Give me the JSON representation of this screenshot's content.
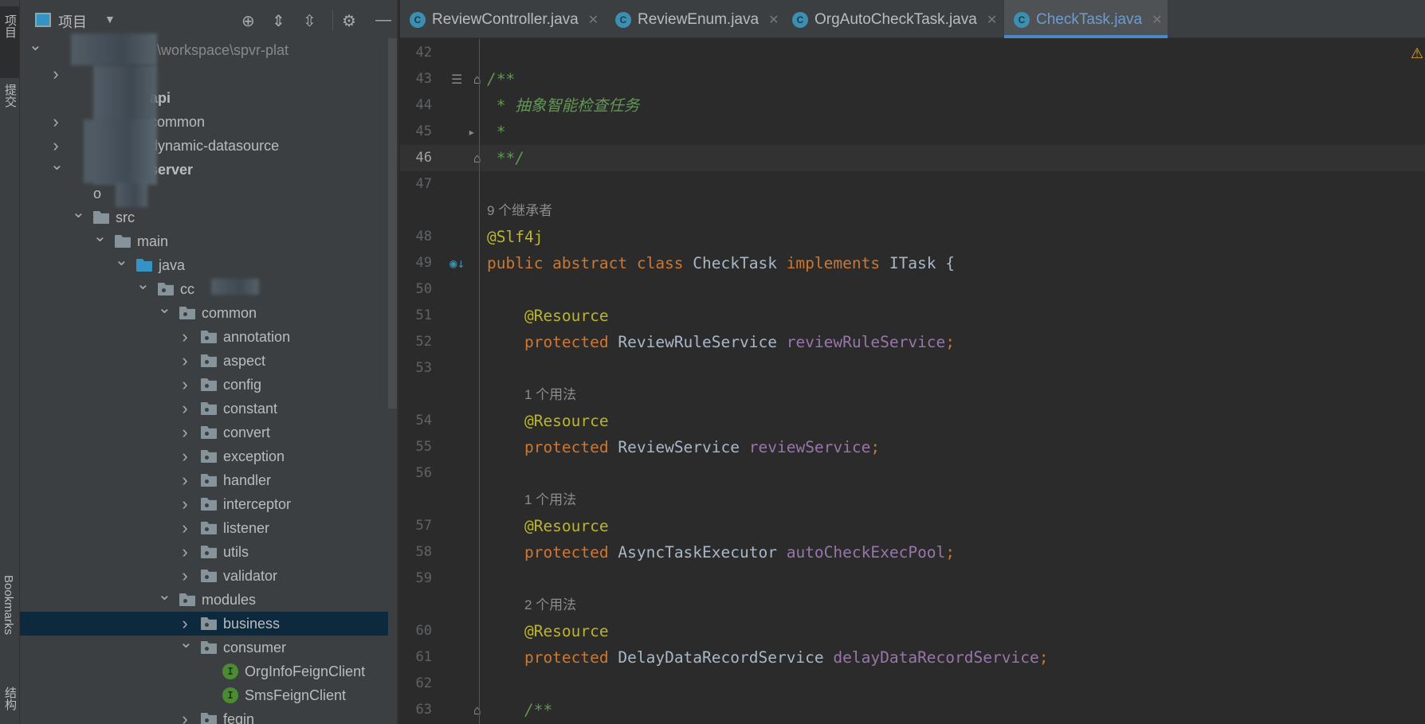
{
  "left_strip": {
    "project": "项目",
    "commit": "提交",
    "bookmarks": "Bookmarks",
    "structure": "结构"
  },
  "panel": {
    "title": "项目",
    "icons": [
      "locate-icon",
      "expand-all-icon",
      "collapse-all-icon",
      "gear-icon",
      "minimize-icon"
    ]
  },
  "tree": [
    {
      "level": 0,
      "label": "\\workspace\\spvr-plat",
      "state": "open",
      "icon": "none",
      "path": true,
      "blur": true
    },
    {
      "level": 1,
      "label": "",
      "state": "closed",
      "icon": "none",
      "blur": true
    },
    {
      "level": 1,
      "label": "api",
      "state": "none",
      "icon": "none",
      "bold": true,
      "blur": true
    },
    {
      "level": 1,
      "label": "common",
      "state": "closed",
      "icon": "none",
      "blur": true
    },
    {
      "level": 1,
      "label": "dynamic-datasource",
      "state": "closed",
      "icon": "none",
      "blur": true
    },
    {
      "level": 1,
      "label": "server",
      "state": "open",
      "icon": "none",
      "bold": true,
      "blur": true
    },
    {
      "level": 2,
      "label": "o",
      "state": "none",
      "icon": "none",
      "blur": true
    },
    {
      "level": 2,
      "label": "src",
      "state": "open",
      "icon": "folder"
    },
    {
      "level": 3,
      "label": "main",
      "state": "open",
      "icon": "folder"
    },
    {
      "level": 4,
      "label": "java",
      "state": "open",
      "icon": "folder-blue"
    },
    {
      "level": 5,
      "label": "cc",
      "state": "open",
      "icon": "package",
      "blur": true
    },
    {
      "level": 6,
      "label": "common",
      "state": "open",
      "icon": "package"
    },
    {
      "level": 7,
      "label": "annotation",
      "state": "closed",
      "icon": "package"
    },
    {
      "level": 7,
      "label": "aspect",
      "state": "closed",
      "icon": "package"
    },
    {
      "level": 7,
      "label": "config",
      "state": "closed",
      "icon": "package"
    },
    {
      "level": 7,
      "label": "constant",
      "state": "closed",
      "icon": "package"
    },
    {
      "level": 7,
      "label": "convert",
      "state": "closed",
      "icon": "package"
    },
    {
      "level": 7,
      "label": "exception",
      "state": "closed",
      "icon": "package"
    },
    {
      "level": 7,
      "label": "handler",
      "state": "closed",
      "icon": "package"
    },
    {
      "level": 7,
      "label": "interceptor",
      "state": "closed",
      "icon": "package"
    },
    {
      "level": 7,
      "label": "listener",
      "state": "closed",
      "icon": "package"
    },
    {
      "level": 7,
      "label": "utils",
      "state": "closed",
      "icon": "package"
    },
    {
      "level": 7,
      "label": "validator",
      "state": "closed",
      "icon": "package"
    },
    {
      "level": 6,
      "label": "modules",
      "state": "open",
      "icon": "package"
    },
    {
      "level": 7,
      "label": "business",
      "state": "closed",
      "icon": "package",
      "selected": true
    },
    {
      "level": 7,
      "label": "consumer",
      "state": "open",
      "icon": "package"
    },
    {
      "level": 8,
      "label": "OrgInfoFeignClient",
      "state": "none",
      "icon": "interface"
    },
    {
      "level": 8,
      "label": "SmsFeignClient",
      "state": "none",
      "icon": "interface"
    },
    {
      "level": 7,
      "label": "fegin",
      "state": "closed",
      "icon": "package"
    }
  ],
  "tabs": [
    {
      "label": "ReviewController.java",
      "active": false
    },
    {
      "label": "ReviewEnum.java",
      "active": false
    },
    {
      "label": "OrgAutoCheckTask.java",
      "active": false
    },
    {
      "label": "CheckTask.java",
      "active": true
    }
  ],
  "colors": {
    "keyword": "#cc7832",
    "annotation": "#bbb529",
    "field": "#9876aa",
    "text": "#a9b7c6",
    "doc_comment": "#629755",
    "accent": "#4a88c7",
    "selection": "#0d293e"
  },
  "code": [
    {
      "num": "42",
      "tokens": []
    },
    {
      "num": "43",
      "gutter": [
        "structure-icon",
        "fold-icon"
      ],
      "tokens": [
        {
          "c": "cm",
          "t": "/**"
        }
      ]
    },
    {
      "num": "44",
      "tokens": [
        {
          "c": "cm",
          "t": " * 抽象智能检查任务"
        }
      ]
    },
    {
      "num": "45",
      "gutter": [
        "arrow-icon"
      ],
      "tokens": [
        {
          "c": "cm",
          "t": " *"
        }
      ]
    },
    {
      "num": "46",
      "current": true,
      "gutter": [
        "fold-icon"
      ],
      "tokens": [
        {
          "c": "cm",
          "t": " **/"
        }
      ]
    },
    {
      "num": "47",
      "tokens": []
    },
    {
      "hint": "9 个继承者",
      "indent": 0
    },
    {
      "num": "48",
      "tokens": [
        {
          "c": "a",
          "t": "@Slf4j"
        }
      ]
    },
    {
      "num": "49",
      "gutter": [
        "overridden-icon"
      ],
      "tokens": [
        {
          "c": "k",
          "t": "public abstract class "
        },
        {
          "c": "t",
          "t": "CheckTask "
        },
        {
          "c": "k",
          "t": "implements "
        },
        {
          "c": "t",
          "t": "ITask {"
        }
      ]
    },
    {
      "num": "50",
      "tokens": []
    },
    {
      "num": "51",
      "tokens": [
        {
          "c": "a",
          "t": "    @Resource"
        }
      ]
    },
    {
      "num": "52",
      "tokens": [
        {
          "c": "k",
          "t": "    protected "
        },
        {
          "c": "t",
          "t": "ReviewRuleService "
        },
        {
          "c": "f",
          "t": "reviewRuleService"
        },
        {
          "c": "k",
          "t": ";"
        }
      ]
    },
    {
      "num": "53",
      "tokens": []
    },
    {
      "hint": "1 个用法",
      "indent": 4
    },
    {
      "num": "54",
      "tokens": [
        {
          "c": "a",
          "t": "    @Resource"
        }
      ]
    },
    {
      "num": "55",
      "tokens": [
        {
          "c": "k",
          "t": "    protected "
        },
        {
          "c": "t",
          "t": "ReviewService "
        },
        {
          "c": "f",
          "t": "reviewService"
        },
        {
          "c": "k",
          "t": ";"
        }
      ]
    },
    {
      "num": "56",
      "tokens": []
    },
    {
      "hint": "1 个用法",
      "indent": 4
    },
    {
      "num": "57",
      "tokens": [
        {
          "c": "a",
          "t": "    @Resource"
        }
      ]
    },
    {
      "num": "58",
      "tokens": [
        {
          "c": "k",
          "t": "    protected "
        },
        {
          "c": "t",
          "t": "AsyncTaskExecutor "
        },
        {
          "c": "f",
          "t": "autoCheckExecPool"
        },
        {
          "c": "k",
          "t": ";"
        }
      ]
    },
    {
      "num": "59",
      "tokens": []
    },
    {
      "hint": "2 个用法",
      "indent": 4
    },
    {
      "num": "60",
      "tokens": [
        {
          "c": "a",
          "t": "    @Resource"
        }
      ]
    },
    {
      "num": "61",
      "tokens": [
        {
          "c": "k",
          "t": "    protected "
        },
        {
          "c": "t",
          "t": "DelayDataRecordService "
        },
        {
          "c": "f",
          "t": "delayDataRecordService"
        },
        {
          "c": "k",
          "t": ";"
        }
      ]
    },
    {
      "num": "62",
      "tokens": []
    },
    {
      "num": "63",
      "gutter": [
        "fold-icon"
      ],
      "tokens": [
        {
          "c": "cm",
          "t": "    /**"
        }
      ]
    }
  ]
}
